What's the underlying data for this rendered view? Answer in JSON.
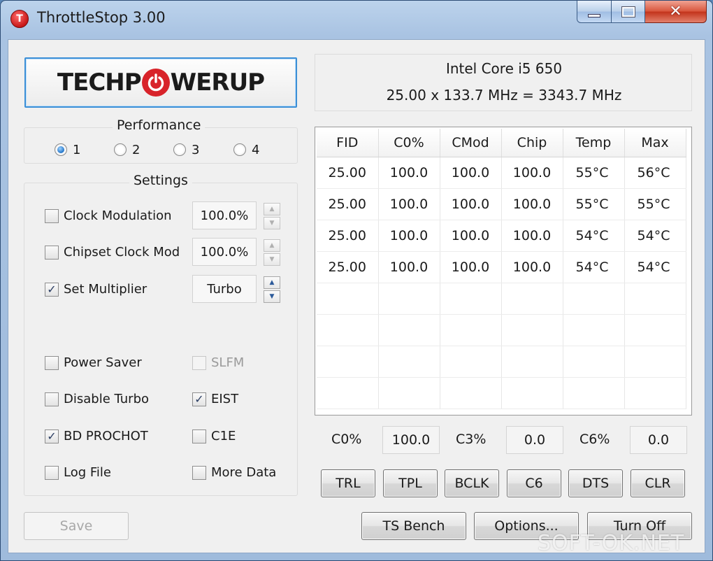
{
  "window": {
    "title": "ThrottleStop 3.00",
    "icon_letter": "T"
  },
  "logo": {
    "left_text": "TECHP",
    "right_text": "WERUP",
    "accent_color": "#d8232a"
  },
  "cpu": {
    "name": "Intel Core i5 650",
    "frequency": "25.00 x 133.7 MHz = 3343.7 MHz"
  },
  "performance": {
    "title": "Performance",
    "options": [
      "1",
      "2",
      "3",
      "4"
    ],
    "selected": "1"
  },
  "settings": {
    "title": "Settings",
    "clock_modulation": {
      "label": "Clock Modulation",
      "checked": false,
      "value": "100.0%"
    },
    "chipset_clock_mod": {
      "label": "Chipset Clock Mod",
      "checked": false,
      "value": "100.0%"
    },
    "set_multiplier": {
      "label": "Set Multiplier",
      "checked": true,
      "value": "Turbo"
    },
    "power_saver": {
      "label": "Power Saver",
      "checked": false
    },
    "slfm": {
      "label": "SLFM",
      "checked": false,
      "disabled": true
    },
    "disable_turbo": {
      "label": "Disable Turbo",
      "checked": false
    },
    "eist": {
      "label": "EIST",
      "checked": true
    },
    "bd_prochot": {
      "label": "BD PROCHOT",
      "checked": true
    },
    "c1e": {
      "label": "C1E",
      "checked": false
    },
    "log_file": {
      "label": "Log File",
      "checked": false
    },
    "more_data": {
      "label": "More Data",
      "checked": false
    }
  },
  "table": {
    "columns": [
      "FID",
      "C0%",
      "CMod",
      "Chip",
      "Temp",
      "Max"
    ],
    "rows": [
      [
        "25.00",
        "100.0",
        "100.0",
        "100.0",
        "55°C",
        "56°C"
      ],
      [
        "25.00",
        "100.0",
        "100.0",
        "100.0",
        "55°C",
        "55°C"
      ],
      [
        "25.00",
        "100.0",
        "100.0",
        "100.0",
        "54°C",
        "54°C"
      ],
      [
        "25.00",
        "100.0",
        "100.0",
        "100.0",
        "54°C",
        "54°C"
      ],
      [
        "",
        "",
        "",
        "",
        "",
        ""
      ],
      [
        "",
        "",
        "",
        "",
        "",
        ""
      ],
      [
        "",
        "",
        "",
        "",
        "",
        ""
      ],
      [
        "",
        "",
        "",
        "",
        "",
        ""
      ]
    ]
  },
  "cstates": {
    "c0_label": "C0%",
    "c0_value": "100.0",
    "c3_label": "C3%",
    "c3_value": "0.0",
    "c6_label": "C6%",
    "c6_value": "0.0"
  },
  "buttons": {
    "trl": "TRL",
    "tpl": "TPL",
    "bclk": "BCLK",
    "c6": "C6",
    "dts": "DTS",
    "clr": "CLR",
    "save": "Save",
    "ts_bench": "TS Bench",
    "options": "Options...",
    "turn_off": "Turn Off"
  },
  "watermark": "SOFT-OK.NET"
}
